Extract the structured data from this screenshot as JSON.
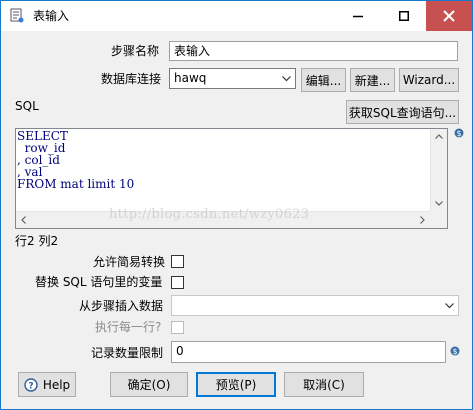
{
  "window": {
    "title": "表输入"
  },
  "form": {
    "step_name_label": "步骤名称",
    "step_name_value": "表输入",
    "db_conn_label": "数据库连接",
    "db_conn_value": "hawq",
    "edit_label": "编辑...",
    "new_label": "新建...",
    "wizard_label": "Wizard...",
    "sql_label": "SQL",
    "get_sql_label": "获取SQL查询语句...",
    "sql_lines": [
      "SELECT",
      "  row_id",
      ", col_id",
      ", val",
      "FROM mat limit 10"
    ],
    "watermark": "http://blog.csdn.net/wzy0623",
    "cursor_pos": "行2 列2",
    "lazy_conv_label": "允许简易转换",
    "replace_vars_label": "替换 SQL 语句里的变量",
    "insert_from_step_label": "从步骤插入数据",
    "insert_from_step_value": "",
    "exec_each_row_label": "执行每一行?",
    "limit_label": "记录数量限制",
    "limit_value": "0"
  },
  "buttons": {
    "help": "Help",
    "ok": "确定(O)",
    "preview": "预览(P)",
    "cancel": "取消(C)"
  },
  "colors": {
    "close_button": "#c75050",
    "sql_text": "#00007a",
    "focus_border": "#0078d7"
  }
}
